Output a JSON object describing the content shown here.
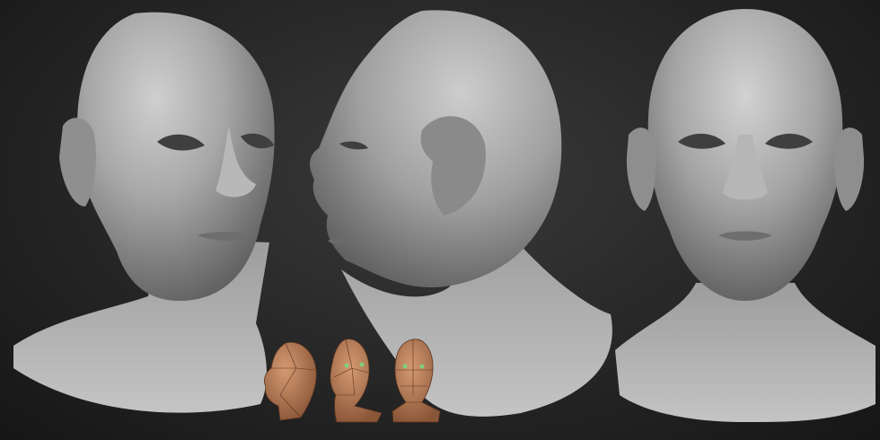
{
  "scene": {
    "background": "#222222",
    "sculpt_color": "#9a9a9a",
    "lowpoly_color": "#b07a58",
    "lowpoly_eye_color": "#7fd07a",
    "views": [
      {
        "name": "three-quarter-head-render"
      },
      {
        "name": "profile-head-render"
      },
      {
        "name": "front-head-render"
      }
    ],
    "lowpoly_views": [
      {
        "name": "lowpoly-profile"
      },
      {
        "name": "lowpoly-three-quarter"
      },
      {
        "name": "lowpoly-front"
      }
    ]
  }
}
